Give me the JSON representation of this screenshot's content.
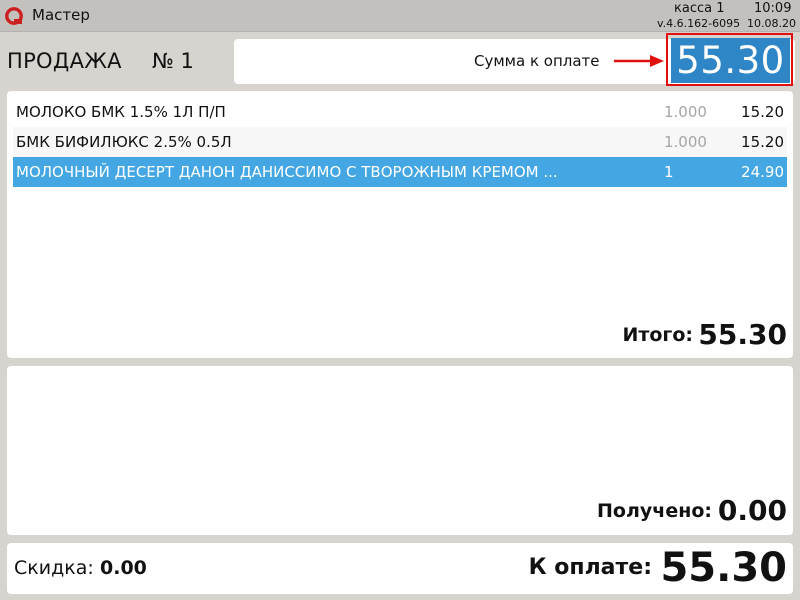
{
  "titlebar": {
    "app_title": "Мастер",
    "register": "касса 1",
    "time": "10:09",
    "version": "v.4.6.162-6095",
    "date": "10.08.20",
    "logo_color": "#cc1f1f"
  },
  "header": {
    "sale_label": "ПРОДАЖА",
    "sale_number": "№ 1",
    "sum_label": "Сумма к оплате",
    "sum_value": "55.30",
    "highlight_color": "#e01010",
    "value_bg": "#2f86c6"
  },
  "items": [
    {
      "name": "МОЛОКО БМК 1.5% 1Л П/П",
      "qty": "1.000",
      "price": "15.20"
    },
    {
      "name": "БМК БИФИЛЮКС 2.5% 0.5Л",
      "qty": "1.000",
      "price": "15.20"
    },
    {
      "name": "МОЛОЧНЫЙ ДЕСЕРТ ДАНОН ДАНИССИМО С ТВОРОЖНЫМ КРЕМОМ ...",
      "qty": "1",
      "price": "24.90",
      "selected": true
    }
  ],
  "totals": {
    "total_label": "Итого:",
    "total_value": "55.30",
    "received_label": "Получено:",
    "received_value": "0.00"
  },
  "footer": {
    "discount_label": "Скидка:",
    "discount_value": "0.00",
    "pay_label": "К оплате:",
    "pay_value": "55.30"
  }
}
